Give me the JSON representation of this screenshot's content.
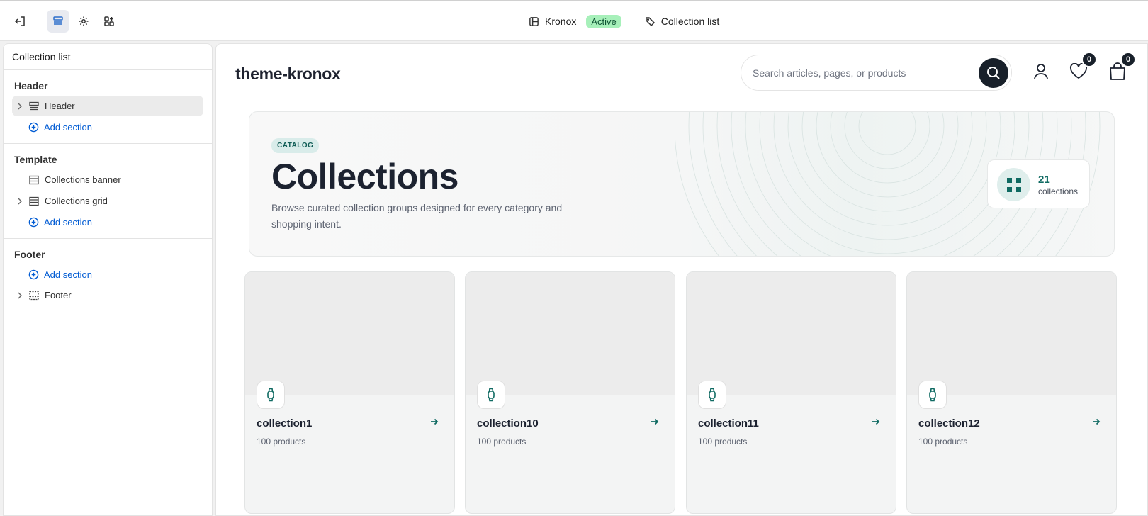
{
  "topbar": {
    "store_name": "Kronox",
    "store_status": "Active",
    "page_name": "Collection list"
  },
  "sidebar": {
    "title": "Collection list",
    "groups": [
      {
        "title": "Header",
        "items": [
          "Header"
        ],
        "add_label": "Add section"
      },
      {
        "title": "Template",
        "items": [
          "Collections banner",
          "Collections grid"
        ],
        "add_label": "Add section"
      },
      {
        "title": "Footer",
        "items": [
          "Footer"
        ],
        "add_label": "Add section"
      }
    ]
  },
  "preview": {
    "logo": "theme-kronox",
    "search_placeholder": "Search articles, pages, or products",
    "wishlist_count": "0",
    "cart_count": "0",
    "banner": {
      "chip": "CATALOG",
      "title": "Collections",
      "description": "Browse curated collection groups designed for every category and shopping intent.",
      "count_number": "21",
      "count_label": "collections"
    },
    "collections": [
      {
        "name": "collection1",
        "count": "100 products"
      },
      {
        "name": "collection10",
        "count": "100 products"
      },
      {
        "name": "collection11",
        "count": "100 products"
      },
      {
        "name": "collection12",
        "count": "100 products"
      }
    ]
  },
  "colors": {
    "accent_blue": "#005bd3",
    "teal": "#0f6a62",
    "active_badge": "#a7f0ba",
    "dark": "#18202a"
  }
}
